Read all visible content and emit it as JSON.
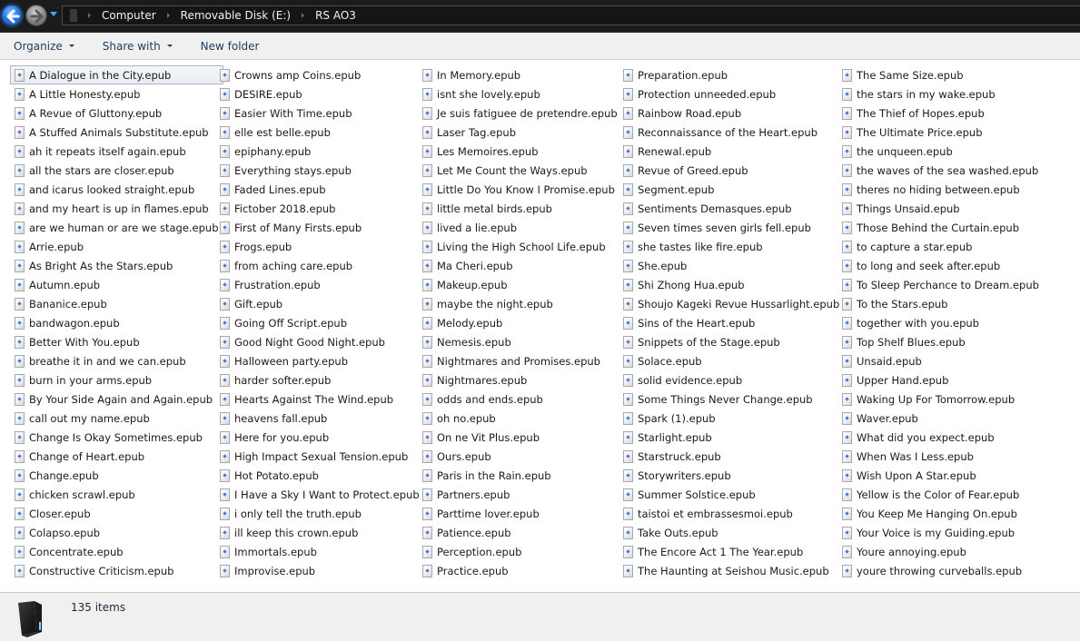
{
  "navigation": {
    "back_icon": "back-arrow-icon",
    "forward_icon": "forward-arrow-icon",
    "history_dropdown_icon": "chevron-down-icon"
  },
  "address_bar": {
    "root_icon": "computer-icon",
    "breadcrumbs": [
      "Computer",
      "Removable Disk (E:)",
      "RS AO3"
    ]
  },
  "toolbar": {
    "organize_label": "Organize",
    "share_label": "Share with",
    "new_folder_label": "New folder"
  },
  "file_list": {
    "file_icon": "epub-file-icon",
    "selected_index": 0,
    "columns": [
      [
        "A Dialogue in the City.epub",
        "A Little Honesty.epub",
        "A Revue of Gluttony.epub",
        "A Stuffed Animals Substitute.epub",
        "ah it repeats itself again.epub",
        "all the stars are closer.epub",
        "and icarus looked straight.epub",
        "and my heart is up in flames.epub",
        "are we human or are we stage.epub",
        "Arrie.epub",
        "As Bright As the Stars.epub",
        "Autumn.epub",
        "Bananice.epub",
        "bandwagon.epub",
        "Better With You.epub",
        "breathe it in and we can.epub",
        "burn in your arms.epub",
        "By Your Side Again and Again.epub",
        "call out my name.epub",
        "Change Is Okay Sometimes.epub",
        "Change of Heart.epub",
        "Change.epub",
        "chicken scrawl.epub",
        "Closer.epub",
        "Colapso.epub",
        "Concentrate.epub",
        "Constructive Criticism.epub"
      ],
      [
        "Crowns amp Coins.epub",
        "DESIRE.epub",
        "Easier With Time.epub",
        "elle est belle.epub",
        "epiphany.epub",
        "Everything stays.epub",
        "Faded Lines.epub",
        "Fictober 2018.epub",
        "First of Many Firsts.epub",
        "Frogs.epub",
        "from aching care.epub",
        "Frustration.epub",
        "Gift.epub",
        "Going Off Script.epub",
        "Good Night Good Night.epub",
        "Halloween party.epub",
        "harder softer.epub",
        "Hearts Against The Wind.epub",
        "heavens fall.epub",
        "Here for you.epub",
        "High Impact Sexual Tension.epub",
        "Hot Potato.epub",
        "I Have a Sky I Want to Protect.epub",
        "i only tell the truth.epub",
        "ill keep this crown.epub",
        "Immortals.epub",
        "Improvise.epub"
      ],
      [
        "In Memory.epub",
        "isnt she lovely.epub",
        "Je suis fatiguee de pretendre.epub",
        "Laser Tag.epub",
        "Les Memoires.epub",
        "Let Me Count the Ways.epub",
        "Little Do You Know I Promise.epub",
        "little metal birds.epub",
        "lived a lie.epub",
        "Living the High School Life.epub",
        "Ma Cheri.epub",
        "Makeup.epub",
        "maybe the night.epub",
        "Melody.epub",
        "Nemesis.epub",
        "Nightmares and Promises.epub",
        "Nightmares.epub",
        "odds and ends.epub",
        "oh no.epub",
        "On ne Vit Plus.epub",
        "Ours.epub",
        "Paris in the Rain.epub",
        "Partners.epub",
        "Parttime lover.epub",
        "Patience.epub",
        "Perception.epub",
        "Practice.epub"
      ],
      [
        "Preparation.epub",
        "Protection unneeded.epub",
        "Rainbow Road.epub",
        "Reconnaissance of the Heart.epub",
        "Renewal.epub",
        "Revue of Greed.epub",
        "Segment.epub",
        "Sentiments Demasques.epub",
        "Seven times seven girls fell.epub",
        "she tastes like fire.epub",
        "She.epub",
        "Shi Zhong Hua.epub",
        "Shoujo Kageki Revue Hussarlight.epub",
        "Sins of the Heart.epub",
        "Snippets of the Stage.epub",
        "Solace.epub",
        "solid evidence.epub",
        "Some Things Never Change.epub",
        "Spark (1).epub",
        "Starlight.epub",
        "Starstruck.epub",
        "Storywriters.epub",
        "Summer Solstice.epub",
        "taistoi et embrassesmoi.epub",
        "Take Outs.epub",
        "The Encore Act 1 The Year.epub",
        "The Haunting at Seishou Music.epub"
      ],
      [
        "The Same Size.epub",
        "the stars in my wake.epub",
        "The Thief of Hopes.epub",
        "The Ultimate Price.epub",
        "the unqueen.epub",
        "the waves of the sea washed.epub",
        "theres no hiding between.epub",
        "Things Unsaid.epub",
        "Those Behind the Curtain.epub",
        "to capture a star.epub",
        "to long and seek after.epub",
        "To Sleep Perchance to Dream.epub",
        "To the Stars.epub",
        "together with you.epub",
        "Top Shelf Blues.epub",
        "Unsaid.epub",
        "Upper Hand.epub",
        "Waking Up For Tomorrow.epub",
        "Waver.epub",
        "What did you expect.epub",
        "When Was I Less.epub",
        "Wish Upon A Star.epub",
        "Yellow is the Color of Fear.epub",
        "You Keep Me Hanging On.epub",
        "Your Voice is my Guiding.epub",
        "Youre annoying.epub",
        "youre throwing curveballs.epub"
      ]
    ]
  },
  "details_pane": {
    "drive_icon": "removable-disk-icon",
    "item_count": "135 items"
  }
}
